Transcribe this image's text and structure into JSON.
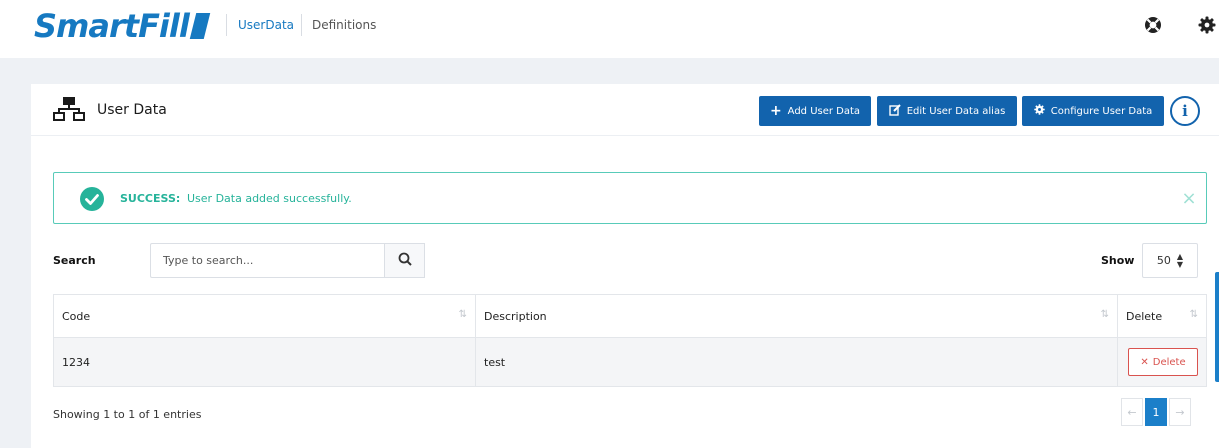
{
  "brand": {
    "name": "SmartFill"
  },
  "nav": {
    "items": [
      "UserData",
      "Definitions"
    ],
    "active_color": "#1679c1"
  },
  "top_icons": [
    "help-icon",
    "gear-icon"
  ],
  "card": {
    "title": "User Data"
  },
  "toolbar": {
    "add_label": "Add User Data",
    "edit_label": "Edit User Data alias",
    "configure_label": "Configure User Data",
    "info_label": "i"
  },
  "alert": {
    "strong": "SUCCESS:",
    "message": "User Data added successfully.",
    "color": "#26b39a"
  },
  "search": {
    "label": "Search",
    "placeholder": "Type to search...",
    "value": ""
  },
  "show": {
    "label": "Show",
    "value": "50"
  },
  "table": {
    "columns": [
      "Code",
      "Description",
      "Delete"
    ],
    "rows": [
      {
        "code": "1234",
        "description": "test",
        "action": "Delete"
      }
    ]
  },
  "footer": {
    "info": "Showing 1 to 1 of 1 entries"
  },
  "pagination": {
    "prev": "←",
    "current": "1",
    "next": "→"
  },
  "colors": {
    "primary": "#1263ad",
    "danger": "#d9534f",
    "accent": "#1b7fc9"
  }
}
